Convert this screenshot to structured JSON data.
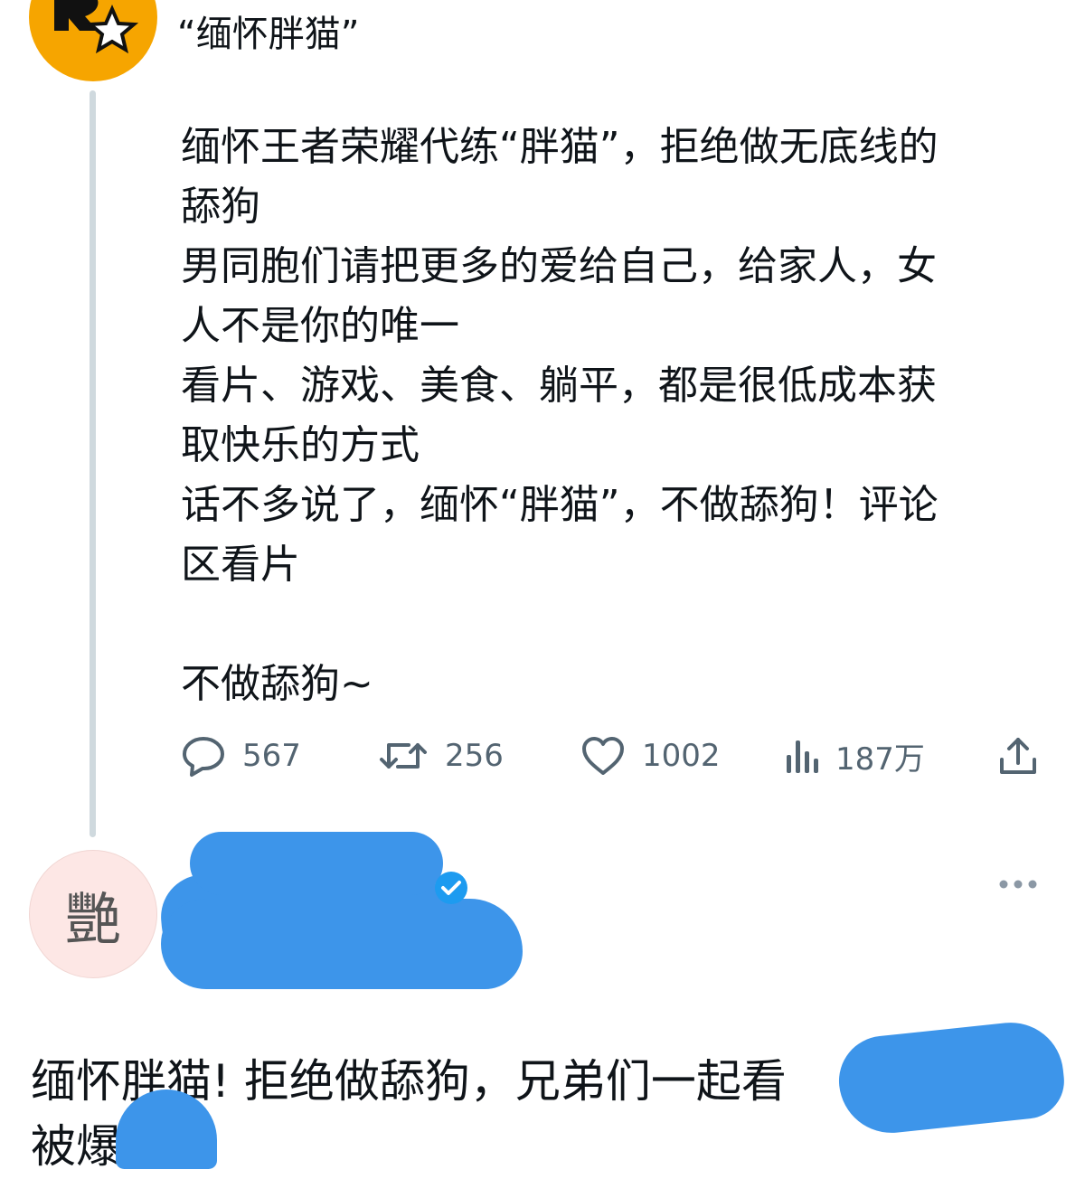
{
  "post": {
    "title": "“缅怀胖猫”",
    "paragraphs": [
      "缅怀王者荣耀代练“胖猫”，拒绝做无底线的",
      "舔狗",
      "男同胞们请把更多的爱给自己，给家人，女",
      "人不是你的唯一",
      "看片、游戏、美食、躺平，都是很低成本获",
      "取快乐的方式",
      "话不多说了，缅怀“胖猫”，不做舔狗！评论",
      "区看片"
    ],
    "closing": "不做舔狗~",
    "stats": {
      "replies": "567",
      "retweets": "256",
      "likes": "1002",
      "views": "187万"
    },
    "icons": {
      "reply": "reply-icon",
      "retweet": "retweet-icon",
      "like": "heart-icon",
      "views": "views-icon",
      "share": "share-icon"
    },
    "avatar_color": "#f6a500"
  },
  "reply": {
    "avatar_char": "艷",
    "avatar_color": "#fde7e5",
    "text_line1": "缅怀胖猫! 拒绝做舔狗，兄弟们一起看",
    "text_line2": "被爆",
    "redaction_color": "#3d95ea"
  }
}
